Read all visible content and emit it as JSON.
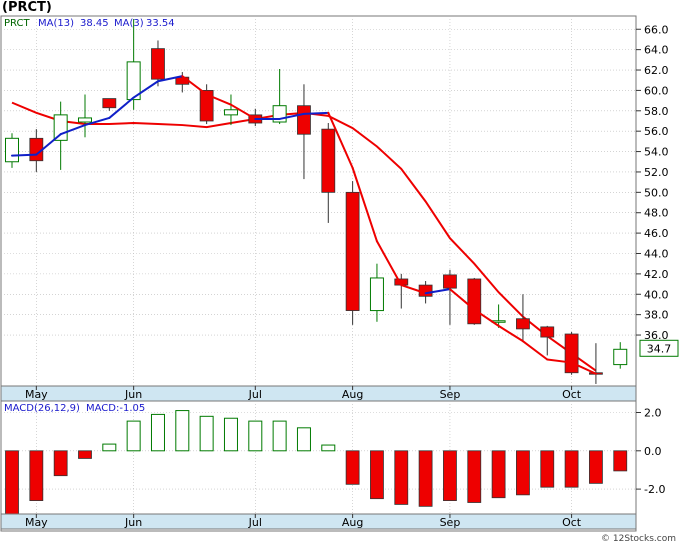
{
  "title": "(PRCT)",
  "credit": "© 12Stocks.com",
  "colors": {
    "up_outline": "#007a00",
    "down_fill": "#ee0000",
    "ma_up": "#1020c8",
    "ma_down": "#ee0000",
    "label_band": "#cfe6f2",
    "grid": "#bbbbbb"
  },
  "chart_data": [
    {
      "type": "candlestick",
      "title": "",
      "legend": [
        {
          "label": "PRCT",
          "color": "#006400"
        },
        {
          "label": "MA(13)",
          "value": "38.45",
          "color": "#1a1acc"
        },
        {
          "label": "MA(3)",
          "value": "33.54",
          "color": "#1a1acc"
        }
      ],
      "x_labels": [
        {
          "label": "May",
          "index": 1
        },
        {
          "label": "Jun",
          "index": 5
        },
        {
          "label": "Jul",
          "index": 10
        },
        {
          "label": "Aug",
          "index": 14
        },
        {
          "label": "Sep",
          "index": 18
        },
        {
          "label": "Oct",
          "index": 23
        }
      ],
      "ylim": [
        31.0,
        67.3
      ],
      "yticks": [
        "66.0",
        "64.0",
        "62.0",
        "60.0",
        "58.0",
        "56.0",
        "54.0",
        "52.0",
        "50.0",
        "48.0",
        "46.0",
        "44.0",
        "42.0",
        "40.0",
        "38.0",
        "36.0"
      ],
      "last_price": "34.7",
      "grid": true,
      "candles": [
        {
          "o": 53.0,
          "h": 55.8,
          "l": 52.4,
          "c": 55.3
        },
        {
          "o": 55.3,
          "h": 56.2,
          "l": 52.0,
          "c": 53.1
        },
        {
          "o": 55.1,
          "h": 58.9,
          "l": 52.2,
          "c": 57.6
        },
        {
          "o": 56.9,
          "h": 59.6,
          "l": 55.4,
          "c": 57.3
        },
        {
          "o": 59.2,
          "h": 59.2,
          "l": 58.0,
          "c": 58.3
        },
        {
          "o": 59.1,
          "h": 67.0,
          "l": 58.1,
          "c": 62.8
        },
        {
          "o": 64.1,
          "h": 64.9,
          "l": 60.4,
          "c": 61.1
        },
        {
          "o": 61.3,
          "h": 61.8,
          "l": 59.8,
          "c": 60.6
        },
        {
          "o": 60.0,
          "h": 60.6,
          "l": 56.7,
          "c": 57.0
        },
        {
          "o": 57.6,
          "h": 59.6,
          "l": 56.6,
          "c": 58.1
        },
        {
          "o": 57.6,
          "h": 58.2,
          "l": 56.5,
          "c": 56.8
        },
        {
          "o": 56.9,
          "h": 62.1,
          "l": 56.7,
          "c": 58.5
        },
        {
          "o": 58.5,
          "h": 60.6,
          "l": 51.3,
          "c": 55.7
        },
        {
          "o": 56.2,
          "h": 56.8,
          "l": 47.0,
          "c": 50.0
        },
        {
          "o": 50.0,
          "h": 51.1,
          "l": 37.0,
          "c": 38.4
        },
        {
          "o": 38.4,
          "h": 43.0,
          "l": 37.3,
          "c": 41.6
        },
        {
          "o": 41.5,
          "h": 42.0,
          "l": 38.6,
          "c": 40.9
        },
        {
          "o": 40.9,
          "h": 41.3,
          "l": 39.1,
          "c": 39.8
        },
        {
          "o": 41.9,
          "h": 42.4,
          "l": 37.0,
          "c": 40.6
        },
        {
          "o": 41.5,
          "h": 41.6,
          "l": 37.0,
          "c": 37.1
        },
        {
          "o": 37.3,
          "h": 39.0,
          "l": 36.7,
          "c": 37.4
        },
        {
          "o": 37.6,
          "h": 40.0,
          "l": 35.5,
          "c": 36.6
        },
        {
          "o": 36.8,
          "h": 36.9,
          "l": 34.0,
          "c": 35.8
        },
        {
          "o": 36.1,
          "h": 36.3,
          "l": 32.1,
          "c": 32.3
        },
        {
          "o": 32.3,
          "h": 35.2,
          "l": 31.2,
          "c": 32.2
        },
        {
          "o": 33.1,
          "h": 35.3,
          "l": 32.7,
          "c": 34.6
        }
      ],
      "ma13": [
        58.8,
        57.8,
        57.0,
        56.7,
        56.7,
        56.8,
        56.7,
        56.6,
        56.4,
        56.8,
        57.2,
        57.6,
        57.8,
        57.5,
        56.3,
        54.5,
        52.3,
        49.1,
        45.5,
        43.0,
        40.2,
        37.8,
        35.9,
        34.2,
        32.5,
        38.4
      ],
      "ma3": [
        53.6,
        53.7,
        55.7,
        56.6,
        57.3,
        59.3,
        60.9,
        61.4,
        59.6,
        58.6,
        57.2,
        57.2,
        57.7,
        57.8,
        52.4,
        45.2,
        40.9,
        40.1,
        40.5,
        38.5,
        36.9,
        35.4,
        33.6,
        33.3,
        32.2,
        33.54
      ]
    },
    {
      "type": "bar",
      "title": "",
      "legend": [
        {
          "label": "MACD(26,12,9)",
          "color": "#1a1acc"
        },
        {
          "label": "MACD:-1.05",
          "color": "#1a1acc"
        }
      ],
      "ylim": [
        -3.3,
        2.6
      ],
      "yticks": [
        "2.0",
        "0.0",
        "-2.0"
      ],
      "values": [
        -3.3,
        -2.6,
        -1.3,
        -0.4,
        0.35,
        1.55,
        1.9,
        2.1,
        1.8,
        1.7,
        1.55,
        1.55,
        1.2,
        0.3,
        -1.75,
        -2.5,
        -2.8,
        -2.9,
        -2.6,
        -2.7,
        -2.45,
        -2.3,
        -1.9,
        -1.9,
        -1.7,
        -1.05
      ]
    }
  ]
}
